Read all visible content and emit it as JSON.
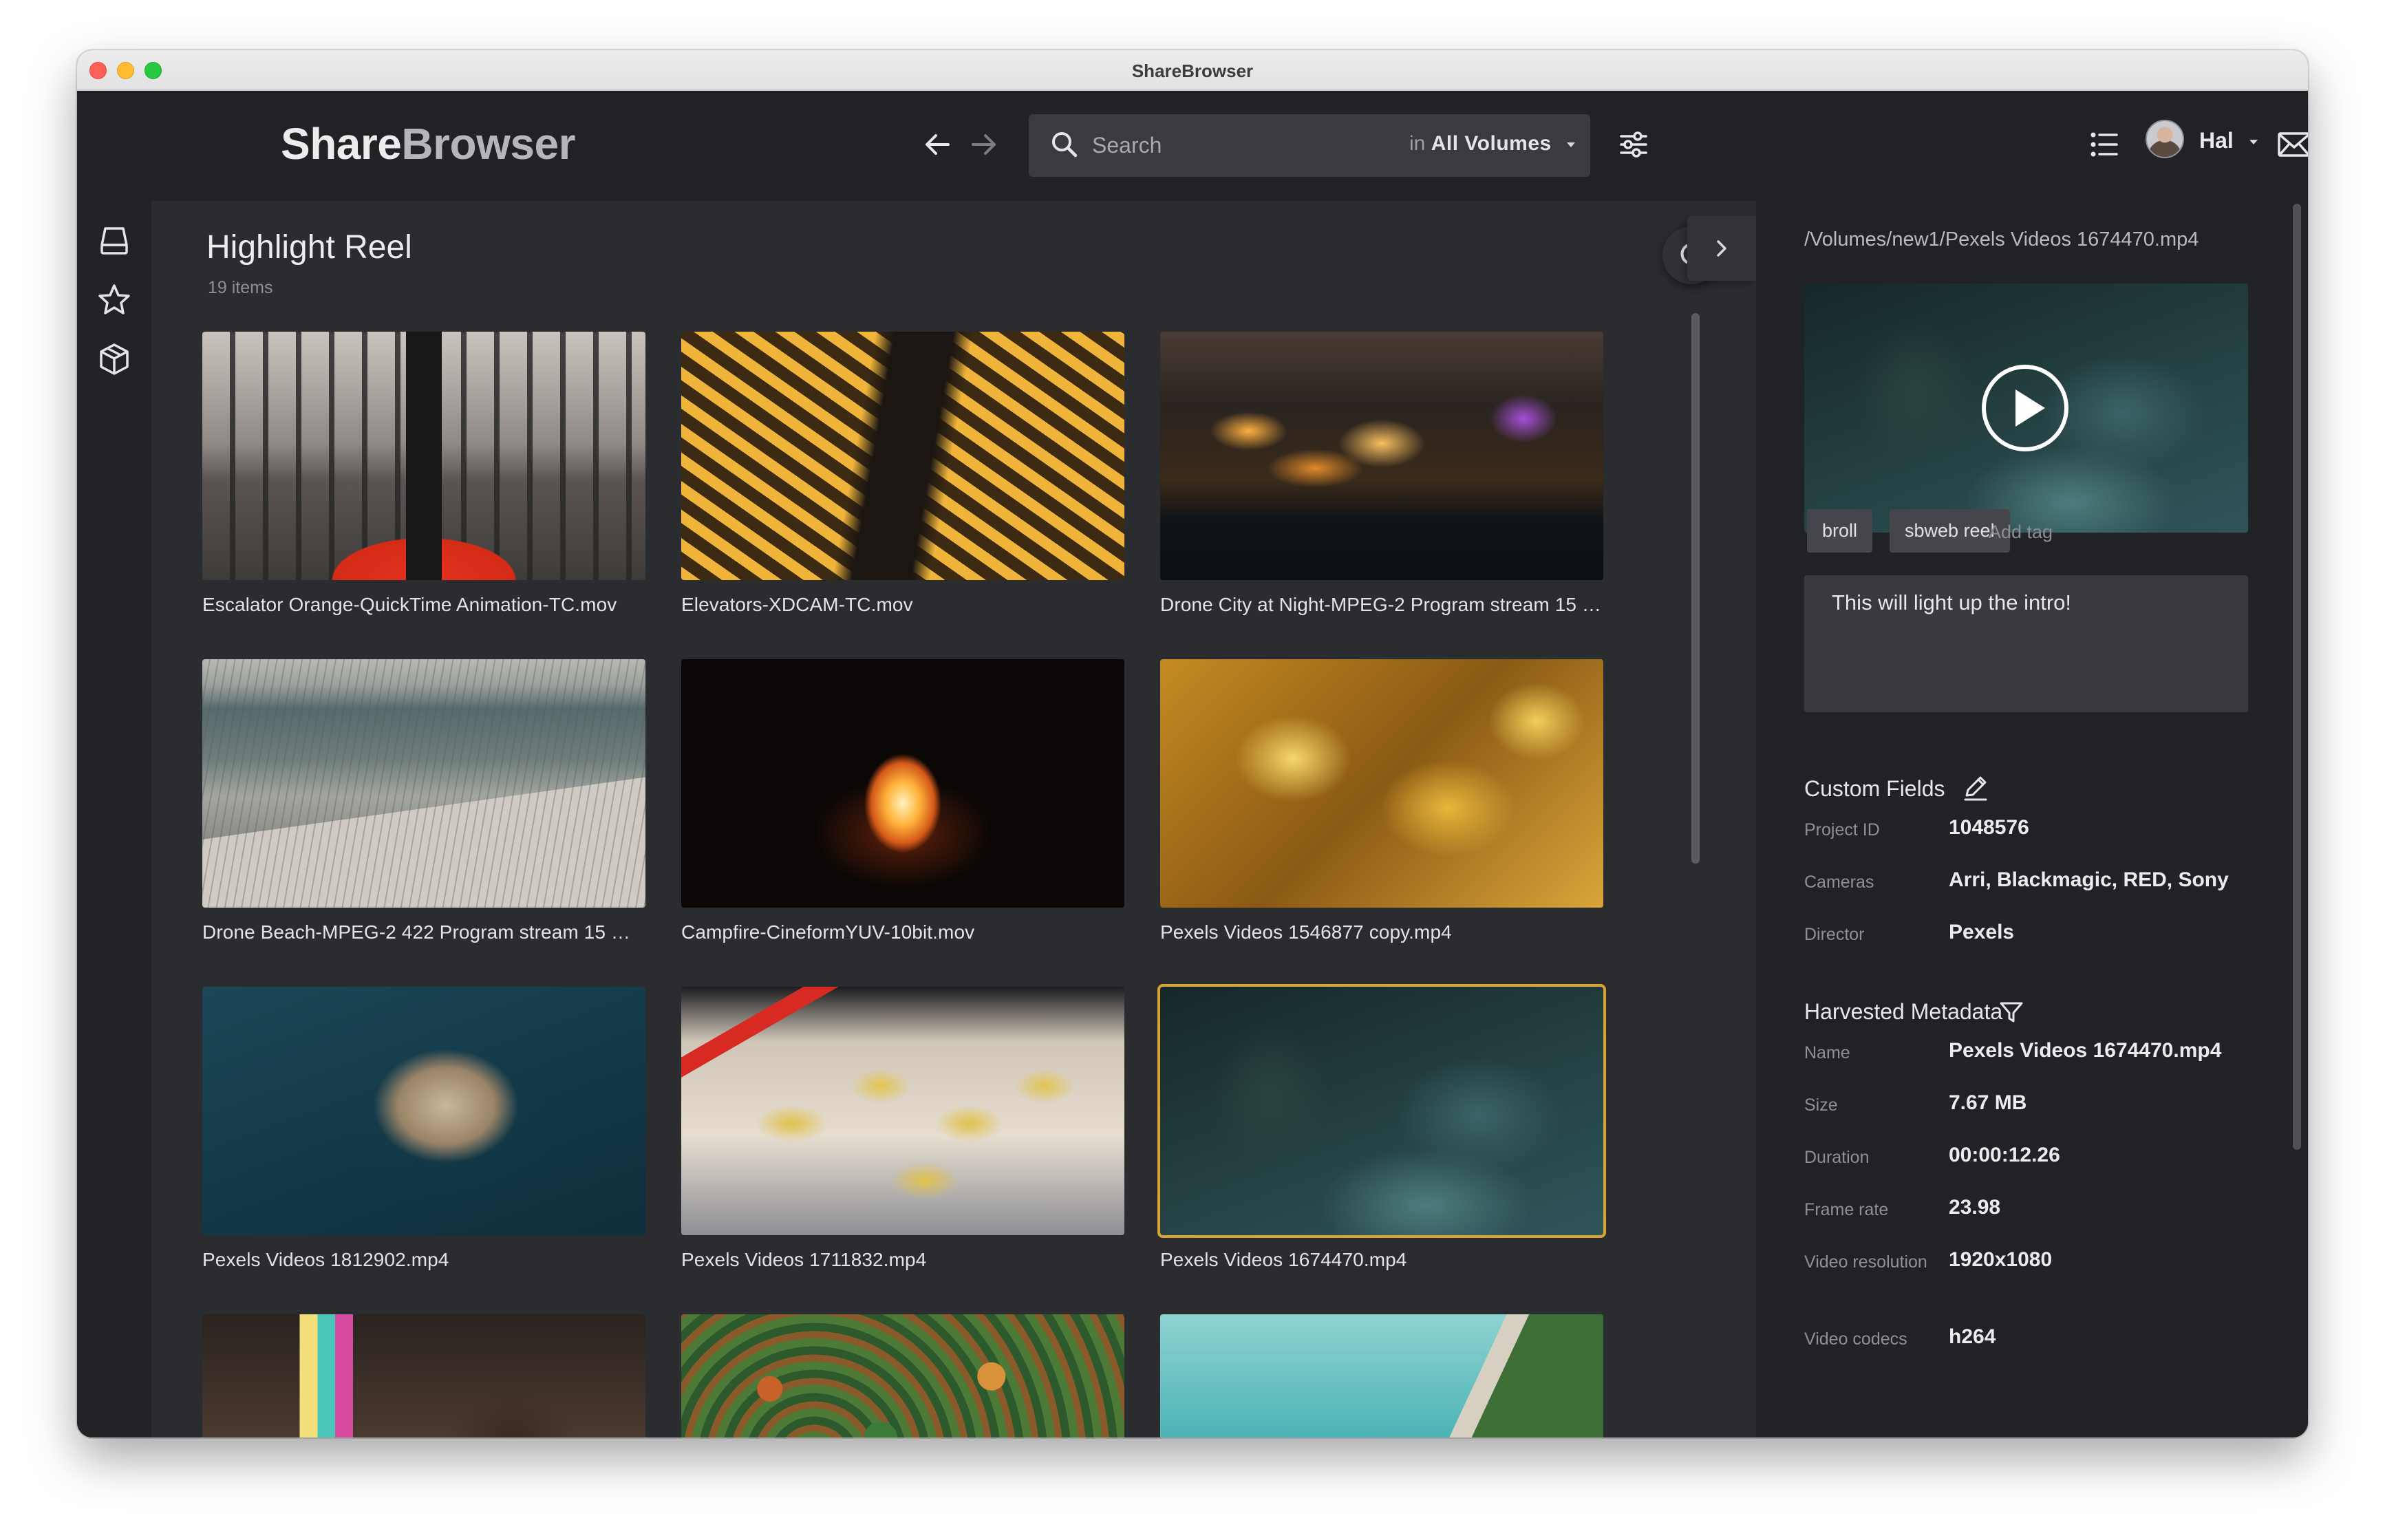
{
  "window": {
    "title": "ShareBrowser"
  },
  "header": {
    "logo_part1": "Share",
    "logo_part2": "Browser",
    "search": {
      "placeholder": "Search",
      "scope_prefix": "in",
      "scope_value": "All Volumes"
    },
    "user": {
      "name": "Hal"
    }
  },
  "sidebar": {
    "items": [
      {
        "name": "volumes",
        "icon": "drive-icon"
      },
      {
        "name": "favorites",
        "icon": "star-icon"
      },
      {
        "name": "collections",
        "icon": "box-icon"
      }
    ]
  },
  "main": {
    "title": "Highlight Reel",
    "count": "19 items",
    "tiles": [
      {
        "label": "Escalator Orange-QuickTime Animation-TC.mov"
      },
      {
        "label": "Elevators-XDCAM-TC.mov"
      },
      {
        "label": "Drone City at Night-MPEG-2 Program stream 15 M..."
      },
      {
        "label": "Drone Beach-MPEG-2 422 Program stream 15 Mb..."
      },
      {
        "label": "Campfire-CineformYUV-10bit.mov"
      },
      {
        "label": "Pexels Videos 1546877 copy.mp4"
      },
      {
        "label": "Pexels Videos 1812902.mp4"
      },
      {
        "label": "Pexels Videos 1711832.mp4"
      },
      {
        "label": "Pexels Videos 1674470.mp4",
        "selected": true
      },
      {
        "label": ""
      },
      {
        "label": ""
      },
      {
        "label": ""
      }
    ]
  },
  "details": {
    "path": "/Volumes/new1/Pexels Videos 1674470.mp4",
    "tags": [
      "broll",
      "sbweb reel"
    ],
    "add_tag_label": "Add tag",
    "comment": "This will light up the intro!",
    "custom_fields": {
      "title": "Custom Fields",
      "rows": [
        {
          "label": "Project ID",
          "value": "1048576"
        },
        {
          "label": "Cameras",
          "value": "Arri, Blackmagic, RED, Sony"
        },
        {
          "label": "Director",
          "value": "Pexels"
        }
      ]
    },
    "harvested": {
      "title": "Harvested Metadata",
      "rows": [
        {
          "label": "Name",
          "value": "Pexels Videos 1674470.mp4"
        },
        {
          "label": "Size",
          "value": "7.67 MB"
        },
        {
          "label": "Duration",
          "value": "00:00:12.26"
        },
        {
          "label": "Frame rate",
          "value": "23.98"
        },
        {
          "label": "Video resolution",
          "value": "1920x1080"
        },
        {
          "label": "Video codecs",
          "value": "h264"
        }
      ]
    }
  },
  "colors": {
    "accent_selected": "#d9a334",
    "background": "#2b2c30",
    "panel": "#212226"
  }
}
